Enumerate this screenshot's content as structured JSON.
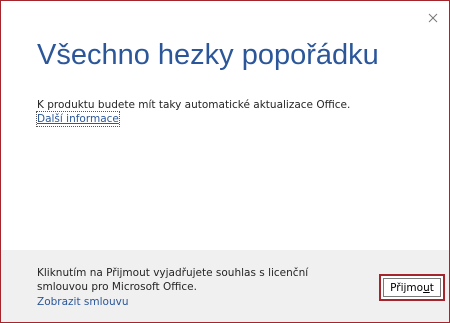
{
  "dialog": {
    "title": "Všechno hezky popořádku",
    "body": "K produktu budete mít taky automatické aktualizace Office.",
    "more_link": "Další informace"
  },
  "footer": {
    "license_text": "Kliknutím na Přijmout vyjadřujete souhlas s licenční smlouvou pro Microsoft Office.",
    "license_link": "Zobrazit smlouvu",
    "accept_button": {
      "before": "Přijmo",
      "accesskey": "u",
      "after": "t"
    }
  },
  "colors": {
    "accent": "#2b579a",
    "border": "#a4262c",
    "footer_bg": "#f0f0f0"
  },
  "icons": {
    "close": "close-icon"
  }
}
